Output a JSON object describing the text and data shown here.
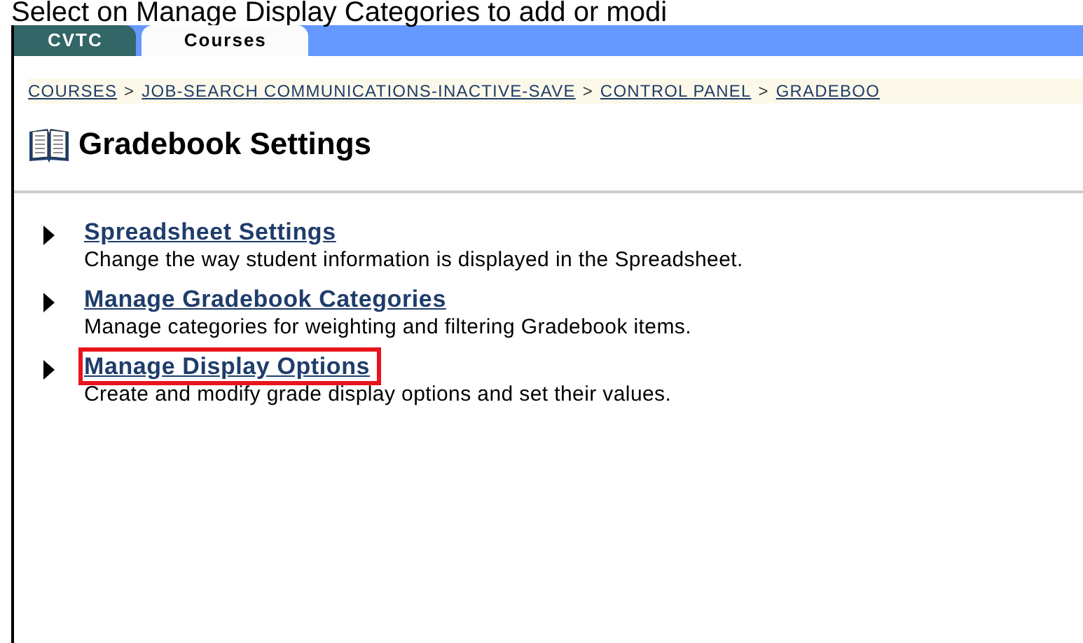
{
  "caption": "Select on Manage Display Categories to add or modi",
  "tabs": [
    {
      "label": "CVTC",
      "selected": false
    },
    {
      "label": "Courses",
      "selected": true
    }
  ],
  "breadcrumb": [
    "COURSES",
    "JOB-SEARCH COMMUNICATIONS-INACTIVE-SAVE",
    "CONTROL PANEL",
    "GRADEBOO"
  ],
  "breadcrumb_separator": ">",
  "page_title": "Gradebook Settings",
  "items": [
    {
      "title": "Spreadsheet Settings",
      "description": "Change the way student information is displayed in the Spreadsheet.",
      "highlighted": false
    },
    {
      "title": "Manage Gradebook Categories",
      "description": "Manage categories for weighting and filtering Gradebook items.",
      "highlighted": false
    },
    {
      "title": "Manage Display Options",
      "description": "Create and modify grade display options and set their values.",
      "highlighted": true
    }
  ]
}
